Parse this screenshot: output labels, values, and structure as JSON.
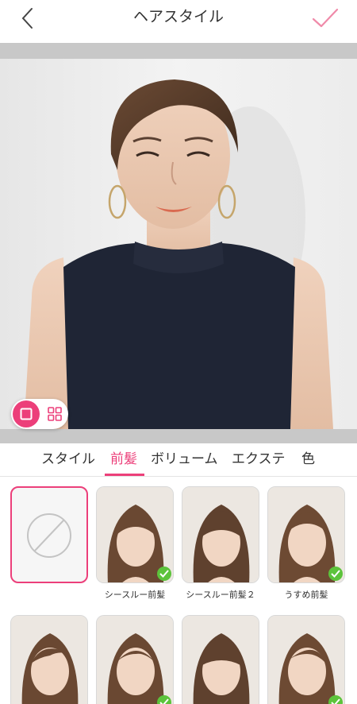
{
  "header": {
    "title": "ヘアスタイル"
  },
  "colors": {
    "accent": "#ec3f7a",
    "badge": "#5cc33b"
  },
  "tabs": [
    {
      "label": "スタイル",
      "active": false
    },
    {
      "label": "前髪",
      "active": true
    },
    {
      "label": "ボリューム",
      "active": false
    },
    {
      "label": "エクステ",
      "active": false
    },
    {
      "label": "色",
      "active": false
    }
  ],
  "bangs": {
    "items": [
      {
        "label": "",
        "icon": "none-icon",
        "selected": true
      },
      {
        "label": "シースルー前髪",
        "checked": true
      },
      {
        "label": "シースルー前髪２",
        "checked": false
      },
      {
        "label": "うすめ前髪",
        "checked": true
      },
      {
        "label": "",
        "checked": false
      },
      {
        "label": "",
        "checked": true
      },
      {
        "label": "",
        "checked": false
      },
      {
        "label": "",
        "checked": true
      }
    ]
  }
}
